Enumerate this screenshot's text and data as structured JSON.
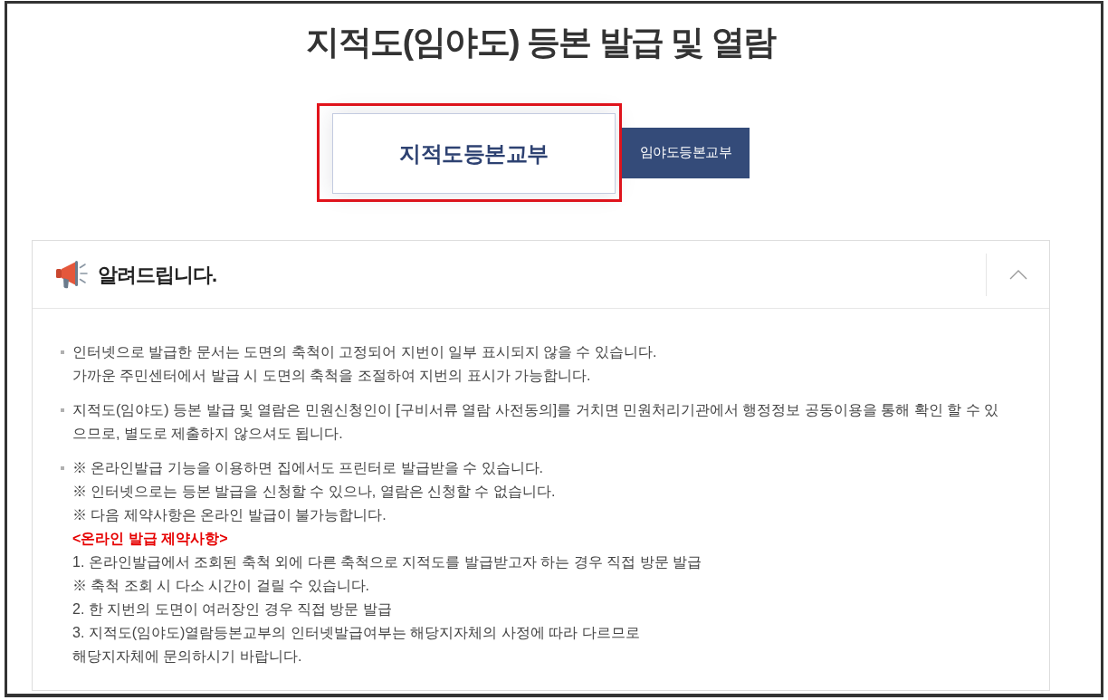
{
  "page": {
    "title": "지적도(임야도) 등본 발급 및 열람"
  },
  "tabs": [
    {
      "label": "지적도등본교부",
      "selected": true,
      "highlighted": true
    },
    {
      "label": "임야도등본교부",
      "selected": false,
      "highlighted": false
    }
  ],
  "notice": {
    "title": "알려드립니다.",
    "expanded": true,
    "items": [
      {
        "paragraphs": [
          {
            "kind": "plain",
            "lines": [
              "인터넷으로 발급한 문서는 도면의 축척이 고정되어 지번이 일부 표시되지 않을 수 있습니다."
            ]
          },
          {
            "kind": "plain",
            "lines": [
              "가까운 주민센터에서 발급 시 도면의 축척을 조절하여 지번의 표시가 가능합니다."
            ]
          }
        ]
      },
      {
        "paragraphs": [
          {
            "kind": "plain",
            "lines": [
              "지적도(임야도) 등본 발급 및 열람은 민원신청인이 [구비서류 열람 사전동의]를 거치면 민원처리기관에서 행정정보 공동이용을 통해 확인 할 수 있",
              "으므로, 별도로 제출하지 않으셔도 됩니다."
            ]
          }
        ]
      },
      {
        "paragraphs": [
          {
            "kind": "plain",
            "lines": [
              "※ 온라인발급 기능을 이용하면 집에서도 프린터로 발급받을 수 있습니다."
            ]
          },
          {
            "kind": "plain",
            "lines": [
              "※ 인터넷으로는 등본 발급을 신청할 수 있으나, 열람은 신청할 수 없습니다."
            ]
          },
          {
            "kind": "plain",
            "lines": [
              "※ 다음 제약사항은 온라인 발급이 불가능합니다."
            ]
          },
          {
            "kind": "warning",
            "lines": [
              "<온라인 발급 제약사항>"
            ]
          },
          {
            "kind": "plain",
            "lines": [
              "1. 온라인발급에서 조회된 축척 외에 다른 축척으로 지적도를 발급받고자 하는 경우 직접 방문 발급"
            ]
          },
          {
            "kind": "plain",
            "lines": [
              "※ 축척 조회 시 다소 시간이 걸릴 수 있습니다."
            ]
          },
          {
            "kind": "plain",
            "lines": [
              "2. 한 지번의 도면이 여러장인 경우 직접 방문 발급"
            ]
          },
          {
            "kind": "plain",
            "lines": [
              "3. 지적도(임야도)열람등본교부의 인터넷발급여부는 해당지자체의 사정에 따라 다르므로",
              "해당지자체에 문의하시기 바랍니다."
            ]
          }
        ]
      }
    ]
  }
}
